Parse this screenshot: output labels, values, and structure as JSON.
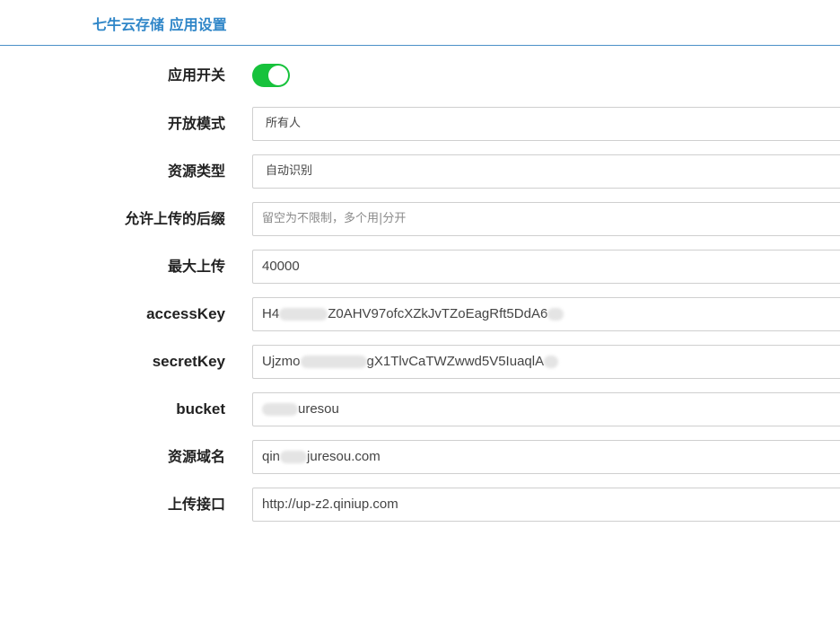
{
  "header": {
    "title": "七牛云存储 应用设置"
  },
  "form": {
    "enable": {
      "label": "应用开关",
      "value": true,
      "color": "#17c23c"
    },
    "mode": {
      "label": "开放模式",
      "value": "所有人"
    },
    "resource_type": {
      "label": "资源类型",
      "value": "自动识别"
    },
    "suffix": {
      "label": "允许上传的后缀",
      "placeholder": "留空为不限制，多个用|分开"
    },
    "max_upload": {
      "label": "最大上传",
      "value": "40000"
    },
    "access_key": {
      "label": "accessKey",
      "prefix": "H4",
      "suffix": "Z0AHV97ofcXZkJvTZoEagRft5DdA6"
    },
    "secret_key": {
      "label": "secretKey",
      "prefix": "Ujzmo",
      "suffix": "gX1TlvCaTWZwwd5V5IuaqlA"
    },
    "bucket": {
      "label": "bucket",
      "suffix": "uresou"
    },
    "domain": {
      "label": "资源域名",
      "prefix": "qin",
      "suffix": "juresou.com"
    },
    "upload_api": {
      "label": "上传接口",
      "value": "http://up-z2.qiniup.com"
    }
  }
}
